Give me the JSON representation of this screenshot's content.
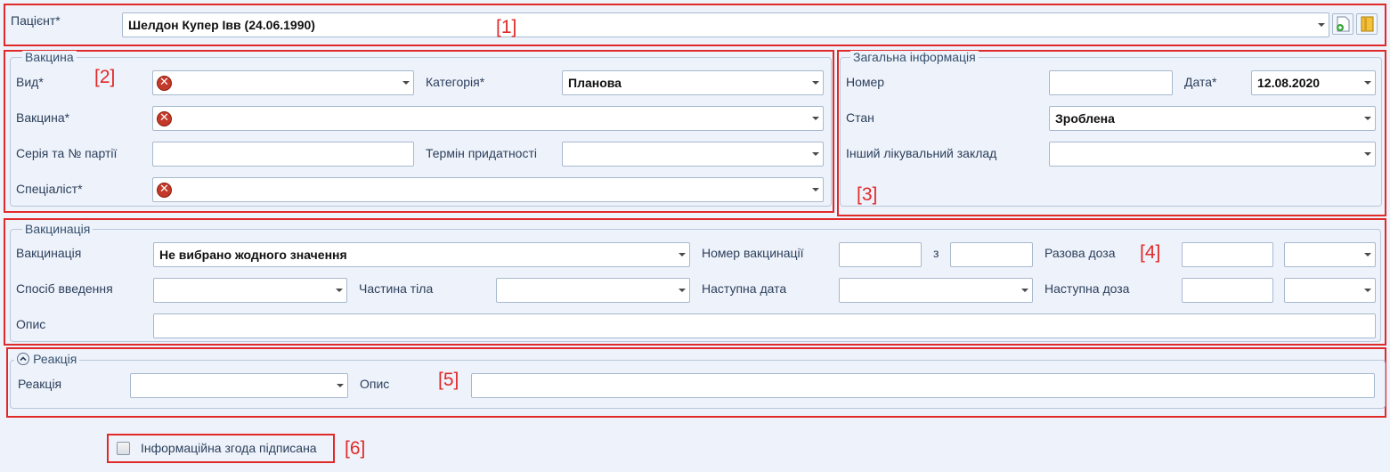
{
  "markers": [
    "[1]",
    "[2]",
    "[3]",
    "[4]",
    "[5]",
    "[6]"
  ],
  "patient": {
    "label": "Пацієнт*",
    "value": "Шелдон Купер Івв (24.06.1990)",
    "icons": [
      "add-document-icon",
      "book-icon"
    ]
  },
  "vaccine": {
    "legend": "Вакцина",
    "kind_label": "Вид*",
    "kind_value": "",
    "category_label": "Категорія*",
    "category_value": "Планова",
    "vaccine_label": "Вакцина*",
    "vaccine_value": "",
    "series_label": "Серія та № партії",
    "series_value": "",
    "expiry_label": "Термін придатності",
    "expiry_value": "",
    "specialist_label": "Спеціаліст*",
    "specialist_value": "",
    "error_icon": "error-icon"
  },
  "general": {
    "legend": "Загальна інформація",
    "number_label": "Номер",
    "number_value": "",
    "date_label": "Дата*",
    "date_value": "12.08.2020",
    "state_label": "Стан",
    "state_value": "Зроблена",
    "other_facility_label": "Інший лікувальний заклад",
    "other_facility_value": ""
  },
  "vaccination": {
    "legend": "Вакцинація",
    "vaccination_label": "Вакцинація",
    "vaccination_value": "Не вибрано жодного значення",
    "number_label": "Номер вакцинації",
    "number_value": "",
    "of_label": "з",
    "of_value": "",
    "single_dose_label": "Разова доза",
    "single_dose_value": "",
    "single_dose_unit": "",
    "method_label": "Спосіб введення",
    "method_value": "",
    "body_part_label": "Частина тіла",
    "body_part_value": "",
    "next_date_label": "Наступна дата",
    "next_date_value": "",
    "next_dose_label": "Наступна доза",
    "next_dose_value": "",
    "next_dose_unit": "",
    "description_label": "Опис",
    "description_value": ""
  },
  "reaction": {
    "legend": "Реакція",
    "collapse_icon": "chevron-up-icon",
    "reaction_label": "Реакція",
    "reaction_value": "",
    "description_label": "Опис",
    "description_value": ""
  },
  "consent": {
    "label": "Інформаційна згода підписана",
    "checked": false
  }
}
